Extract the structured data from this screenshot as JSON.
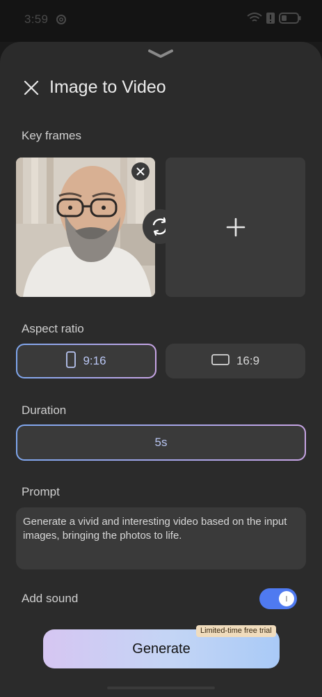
{
  "status_bar": {
    "time": "3:59",
    "icons": [
      "gear-icon",
      "wifi-icon",
      "alert-icon",
      "battery-icon"
    ]
  },
  "sheet": {
    "title": "Image to Video",
    "close_icon": "close-icon",
    "handle_icon": "chevron-down-icon"
  },
  "key_frames": {
    "label": "Key frames",
    "photo_icon": "photo",
    "remove_icon": "close-icon",
    "swap_icon": "swap-icon",
    "add_icon": "plus-icon"
  },
  "aspect_ratio": {
    "label": "Aspect ratio",
    "options": [
      {
        "label": "9:16",
        "icon": "portrait-icon",
        "selected": true
      },
      {
        "label": "16:9",
        "icon": "landscape-icon",
        "selected": false
      }
    ]
  },
  "duration": {
    "label": "Duration",
    "value": "5s"
  },
  "prompt": {
    "label": "Prompt",
    "text": "Generate a vivid and interesting video based on the input images, bringing the photos to life."
  },
  "sound": {
    "label": "Add sound",
    "enabled": true
  },
  "generate": {
    "label": "Generate",
    "badge": "Limited-time free trial"
  },
  "colors": {
    "accent_blue": "#4f7af0",
    "selected_gradient_start": "#7fa7ee",
    "selected_gradient_end": "#c8a5e6",
    "sheet_bg": "#2b2b2b"
  }
}
